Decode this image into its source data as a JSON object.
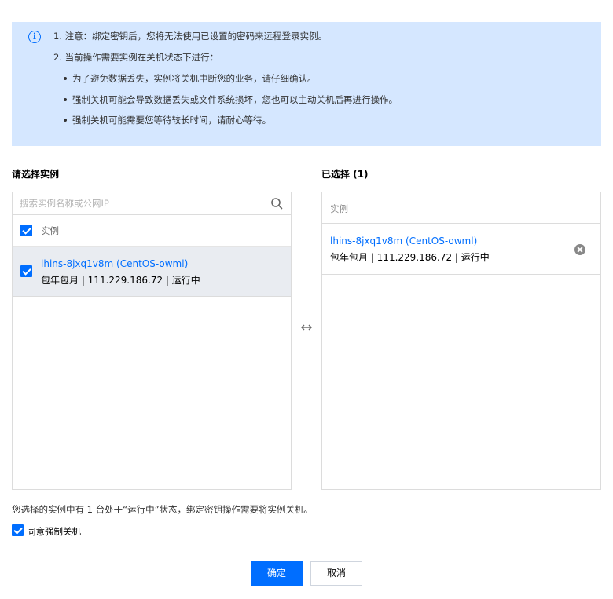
{
  "notice": {
    "line1": "1. 注意：绑定密钥后，您将无法使用已设置的密码来远程登录实例。",
    "line2": "2. 当前操作需要实例在关机状态下进行：",
    "bullets": [
      "为了避免数据丢失，实例将关机中断您的业务，请仔细确认。",
      "强制关机可能会导致数据丢失或文件系统损坏，您也可以主动关机后再进行操作。",
      "强制关机可能需要您等待较长时间，请耐心等待。"
    ]
  },
  "left_panel": {
    "title": "请选择实例",
    "search_placeholder": "搜索实例名称或公网IP",
    "header_label": "实例",
    "items": [
      {
        "name": "lhins-8jxq1v8m (CentOS-owml)",
        "meta": "包年包月 | 111.229.186.72 | 运行中",
        "checked": true
      }
    ]
  },
  "right_panel": {
    "title": "已选择 (1)",
    "header_label": "实例",
    "items": [
      {
        "name": "lhins-8jxq1v8m (CentOS-owml)",
        "meta": "包年包月 | 111.229.186.72 | 运行中"
      }
    ]
  },
  "footer": {
    "warning": "您选择的实例中有 1 台处于“运行中”状态，绑定密钥操作需要将实例关机。",
    "agree_label": "同意强制关机",
    "agree_checked": true,
    "confirm_label": "确定",
    "cancel_label": "取消"
  },
  "colors": {
    "accent": "#006eff",
    "notice_bg": "#d5e7ff",
    "selected_row_bg": "#e9ecf1"
  },
  "icons": [
    "info-icon",
    "search-icon",
    "checkbox-icon",
    "swap-icon",
    "remove-icon"
  ]
}
